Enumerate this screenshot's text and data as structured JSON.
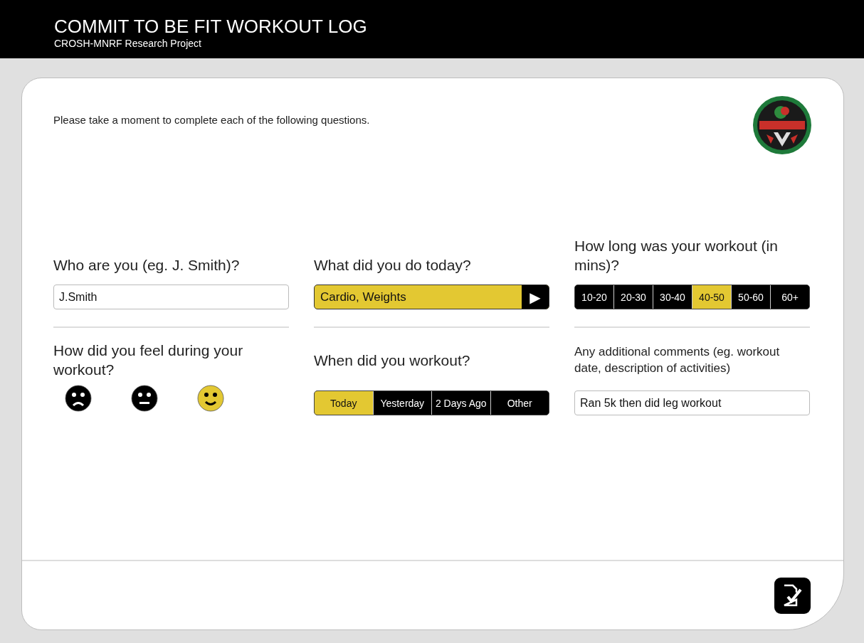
{
  "header": {
    "title": "COMMIT TO BE FIT WORKOUT LOG",
    "subtitle": "CROSH-MNRF Research Project"
  },
  "intro": "Please take a moment to complete each of the following questions.",
  "questions": [
    {
      "kind": "text",
      "label": "Who are you (eg. J. Smith)?",
      "value": "J.Smith"
    },
    {
      "kind": "select",
      "label": "What did you do today?",
      "value": "Cardio, Weights",
      "arrow": "▶"
    },
    {
      "kind": "segments",
      "label": "How long was your workout (in mins)?",
      "options": [
        {
          "label": "10-20",
          "selected": false
        },
        {
          "label": "20-30",
          "selected": false
        },
        {
          "label": "30-40",
          "selected": false
        },
        {
          "label": "40-50",
          "selected": true
        },
        {
          "label": "50-60",
          "selected": false
        },
        {
          "label": "60+",
          "selected": false
        }
      ]
    },
    {
      "kind": "faces",
      "label": "How did you feel during your workout?",
      "options": [
        {
          "kind": "sad",
          "selected": false
        },
        {
          "kind": "neutral",
          "selected": false
        },
        {
          "kind": "happy",
          "selected": true
        }
      ]
    },
    {
      "kind": "segments",
      "label": "When did you workout?",
      "options": [
        {
          "label": "Today",
          "selected": true
        },
        {
          "label": "Yesterday",
          "selected": false
        },
        {
          "label": "2 Days Ago",
          "selected": false
        },
        {
          "label": "Other",
          "selected": false
        }
      ]
    },
    {
      "kind": "comment",
      "label": "Any additional comments (eg. workout date, description of activities)",
      "value": "Ran 5k then did leg workout"
    }
  ]
}
